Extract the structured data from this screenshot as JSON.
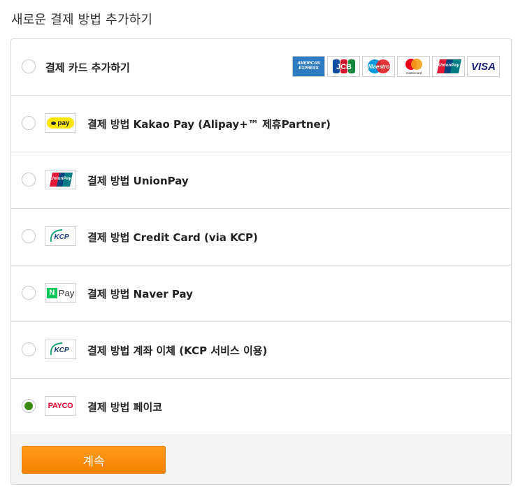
{
  "page": {
    "title": "새로운 결제 방법 추가하기"
  },
  "options": [
    {
      "label": "결제 카드 추가하기",
      "selected": false
    },
    {
      "label": "결제 방법 Kakao Pay (Alipay+™ 제휴Partner)",
      "selected": false,
      "logo": "kakaopay-logo",
      "logo_text": "pay"
    },
    {
      "label": "결제 방법 UnionPay",
      "selected": false,
      "logo": "unionpay-logo"
    },
    {
      "label": "결제 방법 Credit Card (via KCP)",
      "selected": false,
      "logo": "kcp-logo",
      "logo_text": "KCP"
    },
    {
      "label": "결제 방법 Naver Pay",
      "selected": false,
      "logo": "naverpay-logo",
      "logo_text": "Pay"
    },
    {
      "label": "결제 방법 계좌 이체 (KCP 서비스 이용)",
      "selected": false,
      "logo": "kcp-logo",
      "logo_text": "KCP"
    },
    {
      "label": "결제 방법 페이코",
      "selected": true,
      "logo": "payco-logo",
      "logo_text": "PAYCO"
    }
  ],
  "card_brands": [
    {
      "name": "amex-logo",
      "text": "AMERICAN EXPRESS"
    },
    {
      "name": "jcb-logo",
      "text": "JCB"
    },
    {
      "name": "maestro-logo",
      "text": "Maestro"
    },
    {
      "name": "mastercard-logo",
      "text": "mastercard"
    },
    {
      "name": "unionpay-logo",
      "text": "UnionPay"
    },
    {
      "name": "visa-logo",
      "text": "VISA"
    }
  ],
  "unionpay_text": "UnionPay",
  "naver_n": "N",
  "footer": {
    "continue_label": "계속"
  },
  "colors": {
    "accent": "#f58200",
    "radio_selected": "#3b8a12",
    "payco_red": "#e4002b",
    "kakao_yellow": "#ffe600"
  }
}
